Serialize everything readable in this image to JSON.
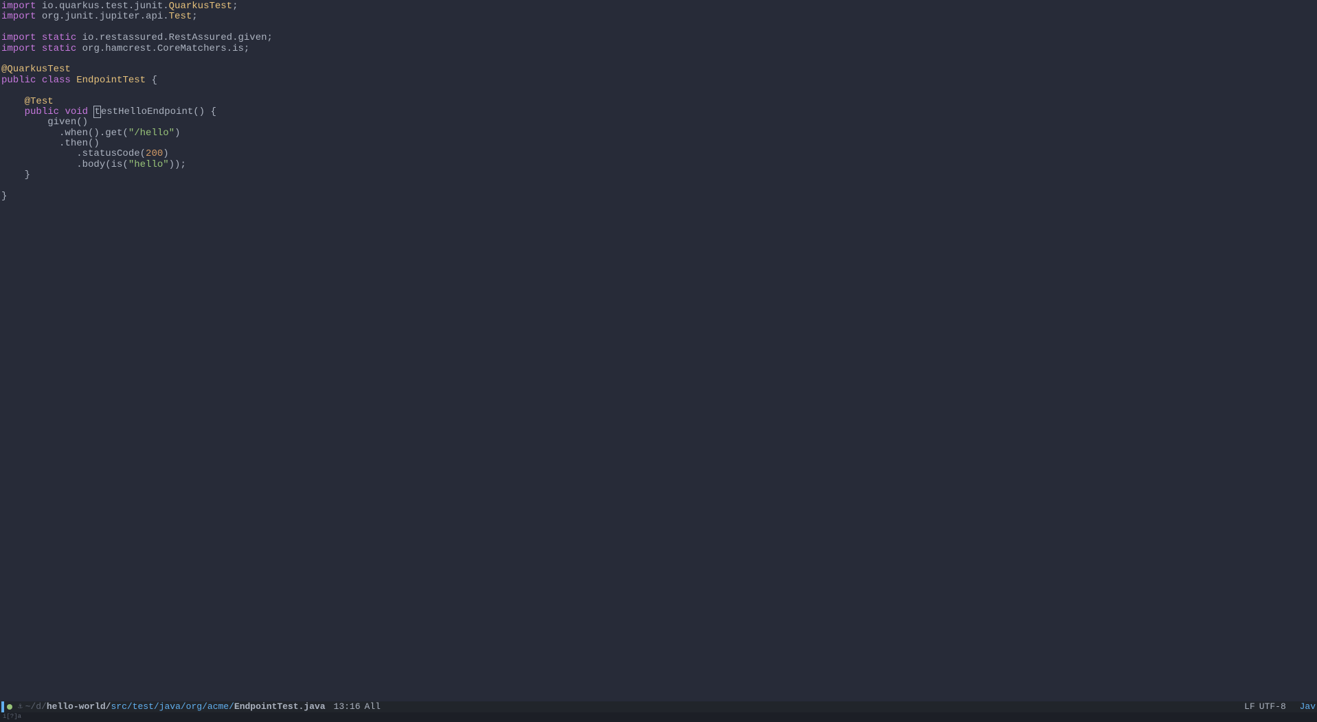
{
  "code": {
    "lines": [
      {
        "tokens": [
          {
            "cls": "keyword-import",
            "t": "import"
          },
          {
            "cls": "plain",
            "t": " io.quarkus.test.junit."
          },
          {
            "cls": "type",
            "t": "QuarkusTest"
          },
          {
            "cls": "punct",
            "t": ";"
          }
        ]
      },
      {
        "tokens": [
          {
            "cls": "keyword-import",
            "t": "import"
          },
          {
            "cls": "plain",
            "t": " org.junit.jupiter.api."
          },
          {
            "cls": "type",
            "t": "Test"
          },
          {
            "cls": "punct",
            "t": ";"
          }
        ]
      },
      {
        "tokens": []
      },
      {
        "tokens": [
          {
            "cls": "keyword-import",
            "t": "import"
          },
          {
            "cls": "plain",
            "t": " "
          },
          {
            "cls": "keyword-static",
            "t": "static"
          },
          {
            "cls": "plain",
            "t": " io.restassured.RestAssured.given;"
          }
        ]
      },
      {
        "tokens": [
          {
            "cls": "keyword-import",
            "t": "import"
          },
          {
            "cls": "plain",
            "t": " "
          },
          {
            "cls": "keyword-static",
            "t": "static"
          },
          {
            "cls": "plain",
            "t": " org.hamcrest.CoreMatchers.is;"
          }
        ]
      },
      {
        "tokens": []
      },
      {
        "tokens": [
          {
            "cls": "annotation",
            "t": "@QuarkusTest"
          }
        ]
      },
      {
        "tokens": [
          {
            "cls": "keyword-public",
            "t": "public"
          },
          {
            "cls": "plain",
            "t": " "
          },
          {
            "cls": "keyword-class",
            "t": "class"
          },
          {
            "cls": "plain",
            "t": " "
          },
          {
            "cls": "type",
            "t": "EndpointTest"
          },
          {
            "cls": "plain",
            "t": " {"
          }
        ]
      },
      {
        "tokens": []
      },
      {
        "tokens": [
          {
            "cls": "plain",
            "t": "    "
          },
          {
            "cls": "annotation",
            "t": "@Test"
          }
        ]
      },
      {
        "tokens": [
          {
            "cls": "plain",
            "t": "    "
          },
          {
            "cls": "keyword-public",
            "t": "public"
          },
          {
            "cls": "plain",
            "t": " "
          },
          {
            "cls": "keyword-void",
            "t": "void"
          },
          {
            "cls": "plain",
            "t": " "
          },
          {
            "cls": "cursor-box",
            "t": "t"
          },
          {
            "cls": "plain",
            "t": "estHelloEndpoint() {"
          }
        ]
      },
      {
        "tokens": [
          {
            "cls": "plain",
            "t": "        given()"
          }
        ]
      },
      {
        "tokens": [
          {
            "cls": "plain",
            "t": "          .when().get("
          },
          {
            "cls": "string",
            "t": "\"/hello\""
          },
          {
            "cls": "plain",
            "t": ")"
          }
        ]
      },
      {
        "tokens": [
          {
            "cls": "plain",
            "t": "          .then()"
          }
        ]
      },
      {
        "tokens": [
          {
            "cls": "plain",
            "t": "             .statusCode("
          },
          {
            "cls": "number",
            "t": "200"
          },
          {
            "cls": "plain",
            "t": ")"
          }
        ]
      },
      {
        "tokens": [
          {
            "cls": "plain",
            "t": "             .body(is("
          },
          {
            "cls": "string",
            "t": "\"hello\""
          },
          {
            "cls": "plain",
            "t": "));"
          }
        ]
      },
      {
        "tokens": [
          {
            "cls": "plain",
            "t": "    }"
          }
        ]
      },
      {
        "tokens": []
      },
      {
        "tokens": [
          {
            "cls": "plain",
            "t": "}"
          }
        ]
      }
    ]
  },
  "status": {
    "path_prefix": "~/d/",
    "path_project": "hello-world/",
    "path_src": "src/test/java/org/acme/",
    "path_file": "EndpointTest.java",
    "position": "13:16",
    "scroll": "All",
    "lineending": "LF",
    "encoding": "UTF-8",
    "language": "Jav"
  },
  "bottom": {
    "left": "i[?]a",
    "right": ""
  }
}
